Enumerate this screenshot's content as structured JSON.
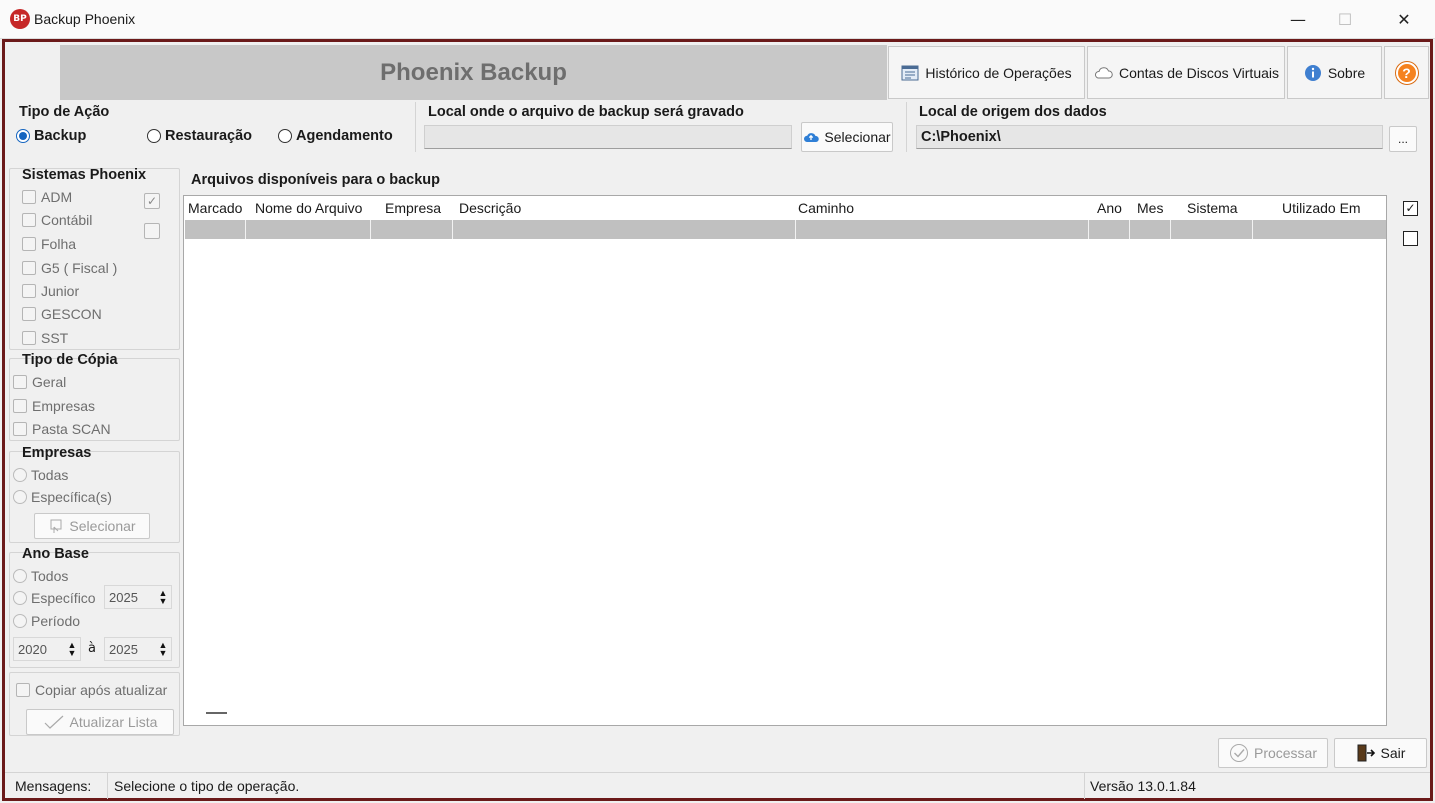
{
  "window": {
    "title": "Backup Phoenix",
    "app_icon_text": "BP",
    "minimize": "—",
    "maximize": "☐",
    "close": "✕"
  },
  "header": {
    "banner": "Phoenix Backup"
  },
  "toolbar": {
    "historico": "Histórico de Operações",
    "contas": "Contas de Discos Virtuais",
    "sobre": "Sobre",
    "help": "?"
  },
  "tipo_acao": {
    "title": "Tipo de Ação",
    "options": [
      "Backup",
      "Restauração",
      "Agendamento"
    ],
    "selected": "Backup"
  },
  "local_destino": {
    "title": "Local onde o arquivo de backup será gravado",
    "value": "",
    "button": "Selecionar"
  },
  "local_origem": {
    "title": "Local de origem dos dados",
    "value": "C:\\Phoenix\\",
    "button": "..."
  },
  "sistemas": {
    "title": "Sistemas Phoenix",
    "items": [
      "ADM",
      "Contábil",
      "Folha",
      "G5 ( Fiscal )",
      "Junior",
      "GESCON",
      "SST"
    ]
  },
  "tipo_copia": {
    "title": "Tipo de Cópia",
    "items": [
      "Geral",
      "Empresas",
      "Pasta SCAN"
    ]
  },
  "empresas": {
    "title": "Empresas",
    "options": [
      "Todas",
      "Específica(s)"
    ],
    "button": "Selecionar"
  },
  "ano_base": {
    "title": "Ano Base",
    "options": [
      "Todos",
      "Específico",
      "Período"
    ],
    "especifico": "2025",
    "de": "2020",
    "separador": "à",
    "ate": "2025"
  },
  "copiar": {
    "label": "Copiar após atualizar",
    "button": "Atualizar Lista"
  },
  "arquivos": {
    "title": "Arquivos disponíveis para o backup",
    "columns": [
      "Marcado",
      "Nome do Arquivo",
      "Empresa",
      "Descrição",
      "Caminho",
      "Ano",
      "Mes",
      "Sistema",
      "Utilizado Em"
    ]
  },
  "actions": {
    "processar": "Processar",
    "sair": "Sair"
  },
  "status": {
    "label": "Mensagens:",
    "message": "Selecione o tipo de operação.",
    "version": "Versão 13.0.1.84"
  },
  "colors": {
    "frame": "#6b1a1a",
    "accent": "#1565c0",
    "banner": "#c8c8c8"
  }
}
